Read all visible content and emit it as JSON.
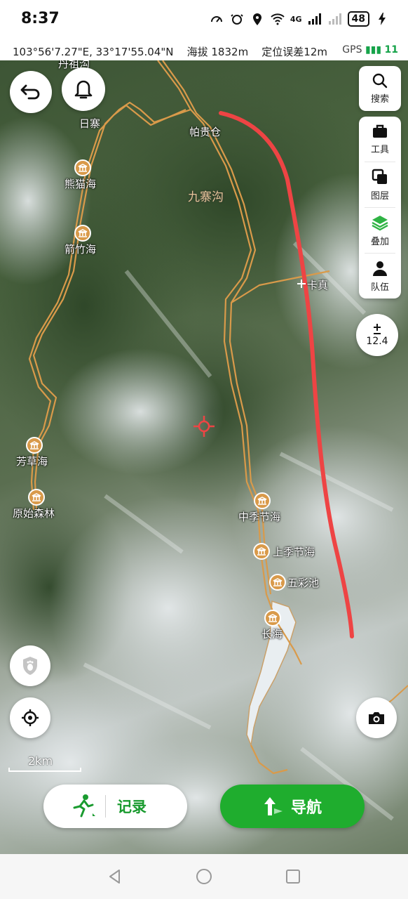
{
  "status_bar": {
    "time": "8:37",
    "network": "4G",
    "battery": "48"
  },
  "coord_bar": {
    "coordinates": "103°56'7.27\"E, 33°17'55.04\"N",
    "altitude": "海拔 1832m",
    "accuracy": "定位误差12m",
    "gps_label": "GPS",
    "gps_satellites": "11"
  },
  "map": {
    "area_label": "九寨沟",
    "labels": {
      "top_cut": "丹祖沟",
      "rizhai": "日寨",
      "paguicang": "帕贵仓",
      "kazhen": "卡真"
    },
    "pois": [
      {
        "name": "熊猫海"
      },
      {
        "name": "箭竹海"
      },
      {
        "name": "芳草海"
      },
      {
        "name": "原始森林"
      },
      {
        "name": "中季节海"
      },
      {
        "name": "上季节海"
      },
      {
        "name": "五彩池"
      },
      {
        "name": "长海"
      }
    ],
    "scale_label": "2km",
    "zoom_level": "12.4",
    "colors": {
      "trail": "#d99a4a",
      "track": "#ee4444",
      "accent": "#1fad2e"
    }
  },
  "toolbar": {
    "search": "搜索",
    "tools": "工具",
    "layers": "图层",
    "overlay": "叠加",
    "team": "队伍"
  },
  "bottom": {
    "record": "记录",
    "navigate": "导航"
  }
}
